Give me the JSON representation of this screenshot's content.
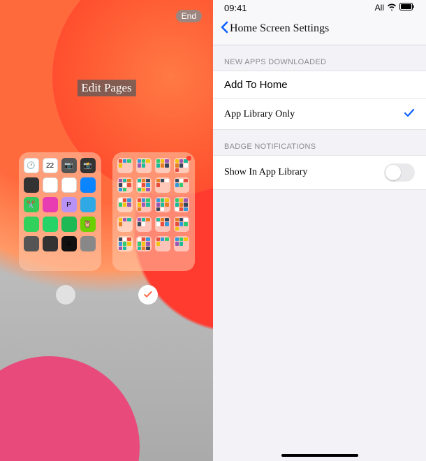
{
  "left": {
    "end_button": "End",
    "title": "Edit Pages",
    "pages": [
      {
        "checked": false
      },
      {
        "checked": true
      }
    ]
  },
  "right": {
    "status": {
      "time": "09:41",
      "carrier": "All"
    },
    "nav": {
      "title": "Home Screen Settings"
    },
    "section1": {
      "header": "NEW APPS DOWNLOADED",
      "opt_add_home": "Add To Home",
      "opt_library_only": "App Library Only",
      "selected": "library"
    },
    "section2": {
      "header": "BADGE NOTIFICATIONS",
      "toggle_label": "Show In App Library",
      "toggle_on": false
    }
  },
  "icon_colors": {
    "page1": [
      "#fff",
      "#fff",
      "#555",
      "#333",
      "#333",
      "#fff",
      "#fff",
      "#0a84ff",
      "#34c759",
      "#e73cb2",
      "#b893f5",
      "#2fa8e6",
      "#32d15b",
      "#25d366",
      "#1db954",
      "#6bcf00",
      "#555",
      "#333",
      "#111",
      "#888"
    ],
    "page2_folders": 20
  }
}
